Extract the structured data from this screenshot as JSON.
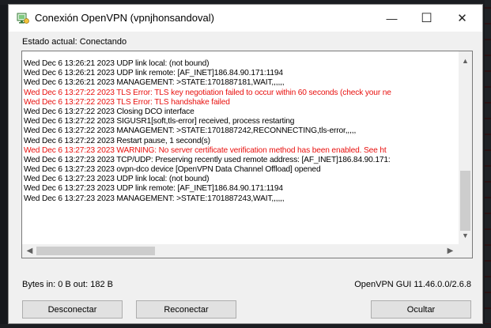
{
  "window": {
    "title": "Conexión OpenVPN (vpnjhonsandoval)",
    "icon": "openvpn-gui-icon",
    "controls": {
      "minimize": "—",
      "maximize": "☐",
      "close": "✕"
    }
  },
  "status": {
    "text": "Estado actual: Conectando"
  },
  "log": {
    "lines": [
      {
        "text": "Wed Dec  6 13:26:21 2023 UDP link local: (not bound)",
        "error": false
      },
      {
        "text": "Wed Dec  6 13:26:21 2023 UDP link remote: [AF_INET]186.84.90.171:1194",
        "error": false
      },
      {
        "text": "Wed Dec  6 13:26:21 2023 MANAGEMENT: >STATE:1701887181,WAIT,,,,,,",
        "error": false
      },
      {
        "text": "Wed Dec  6 13:27:22 2023 TLS Error: TLS key negotiation failed to occur within 60 seconds (check your ne",
        "error": true
      },
      {
        "text": "Wed Dec  6 13:27:22 2023 TLS Error: TLS handshake failed",
        "error": true
      },
      {
        "text": "Wed Dec  6 13:27:22 2023 Closing DCO interface",
        "error": false
      },
      {
        "text": "Wed Dec  6 13:27:22 2023 SIGUSR1[soft,tls-error] received, process restarting",
        "error": false
      },
      {
        "text": "Wed Dec  6 13:27:22 2023 MANAGEMENT: >STATE:1701887242,RECONNECTING,tls-error,,,,,",
        "error": false
      },
      {
        "text": "Wed Dec  6 13:27:22 2023 Restart pause, 1 second(s)",
        "error": false
      },
      {
        "text": "Wed Dec  6 13:27:23 2023 WARNING: No server certificate verification method has been enabled.  See ht",
        "error": true
      },
      {
        "text": "Wed Dec  6 13:27:23 2023 TCP/UDP: Preserving recently used remote address: [AF_INET]186.84.90.171:",
        "error": false
      },
      {
        "text": "Wed Dec  6 13:27:23 2023 ovpn-dco device [OpenVPN Data Channel Offload] opened",
        "error": false
      },
      {
        "text": "Wed Dec  6 13:27:23 2023 UDP link local: (not bound)",
        "error": false
      },
      {
        "text": "Wed Dec  6 13:27:23 2023 UDP link remote: [AF_INET]186.84.90.171:1194",
        "error": false
      },
      {
        "text": "Wed Dec  6 13:27:23 2023 MANAGEMENT: >STATE:1701887243,WAIT,,,,,,",
        "error": false
      }
    ],
    "error_color": "#e8110f"
  },
  "footer": {
    "bytes": "Bytes in: 0 B  out: 182 B",
    "version": "OpenVPN GUI 11.46.0.0/2.6.8"
  },
  "buttons": {
    "disconnect": "Desconectar",
    "reconnect": "Reconectar",
    "hide": "Ocultar"
  }
}
